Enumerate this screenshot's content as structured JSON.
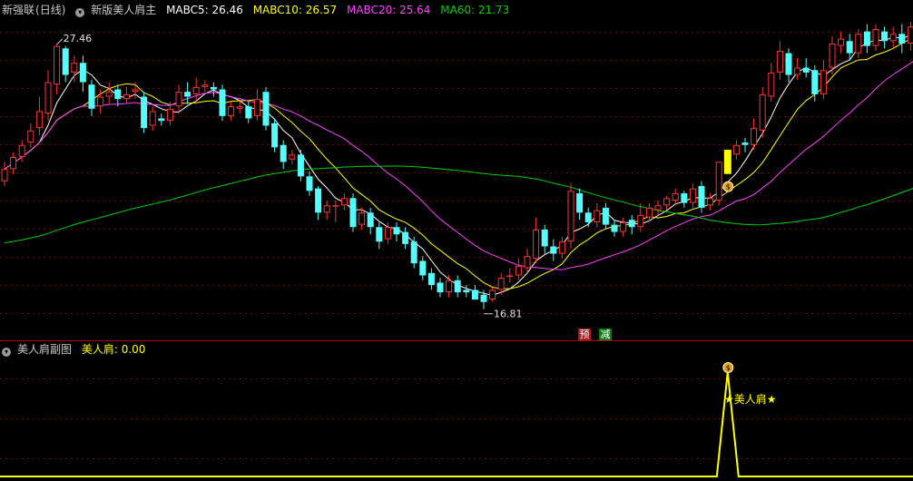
{
  "header": {
    "stock_name": "新强联",
    "period": "(日线)",
    "indicator_name": "新版美人肩主",
    "ma_values": [
      {
        "label": "MABC5: 26.46",
        "color": "#ffffff"
      },
      {
        "label": "MABC10: 26.57",
        "color": "#ffff00"
      },
      {
        "label": "MABC20: 25.64",
        "color": "#ff40ff"
      },
      {
        "label": "MA60: 21.73",
        "color": "#00d000"
      }
    ]
  },
  "sub_header": {
    "indicator_name": "美人肩副图",
    "value_label": "美人肩: 0.00"
  },
  "annotations": {
    "high_label": "27.46",
    "low_label": "16.81",
    "signal_text": "★美人肩★",
    "tag_yu": "预",
    "tag_jian": "减"
  },
  "colors": {
    "up": "#ff3232",
    "down": "#54fcfc",
    "signal_bar": "#ffff00",
    "sub_line": "#ffff00",
    "grid": "#7a0000"
  },
  "chart_data": {
    "type": "candlestick",
    "title": "新版美人肩主",
    "ylim": [
      15.4,
      28.4
    ],
    "grid": true,
    "series": [
      {
        "name": "MABC5",
        "color": "#ffffff"
      },
      {
        "name": "MABC10",
        "color": "#ffff00"
      },
      {
        "name": "MABC20",
        "color": "#ff40ff"
      },
      {
        "name": "MA60",
        "color": "#00d000"
      }
    ],
    "candles": [
      [
        21.8,
        22.3,
        21.6,
        22.6
      ],
      [
        22.3,
        22.8,
        22.1,
        23.0
      ],
      [
        22.8,
        23.3,
        22.6,
        23.5
      ],
      [
        23.4,
        23.9,
        23.2,
        24.2
      ],
      [
        24.0,
        24.7,
        23.7,
        25.3
      ],
      [
        24.6,
        25.9,
        24.3,
        26.4
      ],
      [
        25.8,
        27.4,
        25.4,
        27.46
      ],
      [
        27.3,
        26.2,
        25.9,
        27.4
      ],
      [
        26.3,
        26.7,
        25.9,
        27.0
      ],
      [
        26.7,
        25.9,
        25.5,
        27.0
      ],
      [
        25.8,
        24.8,
        24.5,
        26.0
      ],
      [
        24.9,
        25.3,
        24.6,
        25.6
      ],
      [
        25.3,
        25.5,
        25.0,
        25.9
      ],
      [
        25.6,
        25.2,
        24.9,
        25.8
      ],
      [
        25.2,
        25.4,
        25.0,
        25.7
      ],
      [
        25.5,
        25.6,
        25.2,
        25.9
      ],
      [
        25.3,
        24.0,
        23.8,
        25.5
      ],
      [
        24.1,
        24.7,
        23.9,
        24.9
      ],
      [
        24.4,
        24.3,
        24.1,
        24.6
      ],
      [
        24.3,
        24.8,
        24.1,
        25.1
      ],
      [
        24.9,
        25.5,
        24.6,
        25.8
      ],
      [
        25.5,
        25.3,
        25.0,
        25.9
      ],
      [
        25.4,
        25.7,
        25.1,
        26.1
      ],
      [
        25.7,
        25.8,
        25.5,
        26.0
      ],
      [
        25.7,
        25.6,
        25.3,
        25.9
      ],
      [
        25.6,
        24.5,
        24.3,
        25.8
      ],
      [
        24.5,
        24.9,
        24.3,
        25.1
      ],
      [
        24.8,
        24.9,
        24.6,
        25.1
      ],
      [
        24.9,
        24.4,
        24.2,
        25.1
      ],
      [
        24.5,
        25.2,
        24.3,
        25.6
      ],
      [
        25.5,
        24.1,
        23.9,
        25.7
      ],
      [
        24.2,
        23.2,
        23.0,
        24.4
      ],
      [
        23.3,
        22.6,
        22.3,
        23.5
      ],
      [
        22.7,
        22.9,
        22.5,
        23.1
      ],
      [
        22.9,
        22.0,
        21.8,
        23.1
      ],
      [
        22.0,
        21.4,
        21.2,
        22.2
      ],
      [
        21.5,
        20.5,
        20.2,
        21.6
      ],
      [
        20.5,
        20.8,
        20.2,
        21.0
      ],
      [
        20.8,
        20.8,
        20.1,
        21.0
      ],
      [
        20.8,
        21.1,
        20.6,
        21.3
      ],
      [
        21.1,
        19.9,
        19.7,
        21.3
      ],
      [
        20.0,
        20.5,
        19.8,
        20.7
      ],
      [
        20.5,
        19.9,
        19.6,
        20.7
      ],
      [
        19.9,
        19.3,
        19.0,
        20.1
      ],
      [
        19.4,
        19.9,
        19.2,
        20.1
      ],
      [
        19.9,
        19.6,
        19.3,
        20.1
      ],
      [
        19.7,
        19.2,
        19.0,
        19.9
      ],
      [
        19.3,
        18.4,
        18.2,
        19.5
      ],
      [
        18.5,
        17.9,
        17.7,
        18.7
      ],
      [
        18.0,
        17.5,
        17.3,
        18.2
      ],
      [
        17.6,
        17.2,
        17.0,
        17.8
      ],
      [
        17.2,
        17.7,
        17.0,
        17.9
      ],
      [
        17.7,
        17.2,
        17.0,
        17.9
      ],
      [
        17.3,
        17.2,
        17.0,
        17.5
      ],
      [
        17.3,
        16.9,
        16.9,
        17.5
      ],
      [
        17.1,
        16.8,
        16.5,
        17.3
      ],
      [
        16.9,
        17.3,
        16.81,
        17.4
      ],
      [
        17.3,
        17.8,
        17.1,
        18.0
      ],
      [
        17.9,
        17.9,
        17.6,
        18.2
      ],
      [
        17.9,
        18.3,
        17.7,
        18.6
      ],
      [
        18.2,
        18.7,
        18.0,
        19.0
      ],
      [
        18.6,
        19.8,
        18.4,
        20.3
      ],
      [
        19.8,
        19.1,
        18.8,
        20.0
      ],
      [
        19.1,
        18.8,
        18.5,
        19.4
      ],
      [
        18.8,
        19.3,
        18.6,
        19.5
      ],
      [
        19.3,
        21.4,
        19.0,
        21.7
      ],
      [
        21.3,
        20.5,
        20.2,
        21.5
      ],
      [
        20.5,
        20.1,
        19.9,
        20.7
      ],
      [
        20.1,
        20.6,
        19.9,
        20.9
      ],
      [
        20.7,
        20.0,
        19.8,
        20.9
      ],
      [
        20.0,
        19.7,
        19.5,
        20.2
      ],
      [
        19.7,
        20.1,
        19.5,
        20.3
      ],
      [
        20.2,
        19.9,
        19.6,
        20.4
      ],
      [
        19.9,
        20.4,
        19.7,
        20.9
      ],
      [
        20.3,
        20.7,
        20.1,
        20.9
      ],
      [
        20.6,
        20.8,
        20.4,
        21.0
      ],
      [
        20.8,
        21.1,
        20.6,
        21.2
      ],
      [
        21.0,
        21.3,
        20.8,
        21.5
      ],
      [
        21.3,
        20.9,
        20.7,
        21.4
      ],
      [
        20.9,
        21.5,
        20.7,
        21.7
      ],
      [
        21.6,
        20.7,
        20.5,
        21.8
      ],
      [
        20.8,
        21.1,
        20.6,
        21.3
      ],
      [
        21.0,
        22.6,
        20.8,
        22.6
      ],
      [
        22.3,
        22.9,
        22.1,
        23.1
      ],
      [
        22.9,
        23.3,
        22.7,
        23.5
      ],
      [
        23.4,
        23.3,
        23.0,
        23.6
      ],
      [
        23.3,
        24.0,
        23.1,
        24.4
      ],
      [
        23.9,
        25.4,
        23.6,
        25.7
      ],
      [
        25.3,
        26.3,
        25.1,
        26.7
      ],
      [
        26.3,
        27.2,
        26.0,
        27.6
      ],
      [
        27.1,
        26.2,
        25.9,
        27.3
      ],
      [
        26.2,
        26.5,
        26.0,
        26.9
      ],
      [
        26.5,
        26.3,
        26.1,
        26.9
      ],
      [
        26.4,
        25.4,
        25.1,
        26.6
      ],
      [
        25.4,
        26.4,
        25.2,
        26.8
      ],
      [
        26.5,
        27.5,
        26.2,
        27.8
      ],
      [
        27.4,
        27.7,
        27.1,
        28.0
      ],
      [
        27.6,
        27.1,
        26.8,
        27.9
      ],
      [
        27.1,
        27.9,
        26.9,
        28.1
      ],
      [
        28.0,
        27.4,
        27.1,
        28.3
      ],
      [
        27.4,
        28.1,
        27.2,
        28.3
      ],
      [
        28.0,
        27.6,
        27.3,
        28.2
      ],
      [
        27.6,
        27.9,
        27.3,
        28.2
      ],
      [
        27.9,
        27.5,
        27.1,
        28.3
      ],
      [
        27.5,
        28.2,
        27.2,
        28.4
      ],
      [
        28.1,
        27.6,
        27.3,
        28.3
      ],
      [
        27.6,
        27.5,
        27.1,
        27.8
      ]
    ],
    "signal_index": 83,
    "ma5_last": 26.46,
    "ma10_last": 26.57,
    "ma20_last": 25.64,
    "ma60_last": 21.73,
    "sub_chart": {
      "name": "美人肩",
      "value": 0.0,
      "peak": 1
    }
  }
}
